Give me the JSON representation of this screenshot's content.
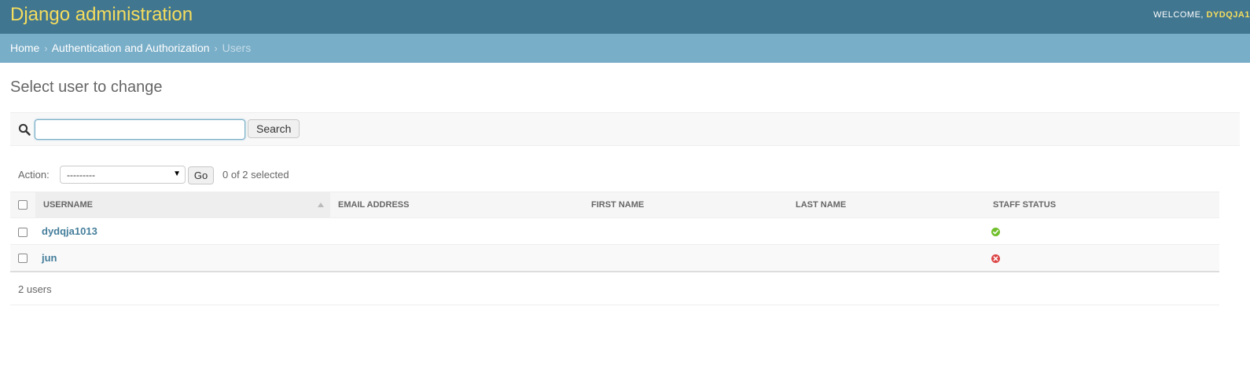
{
  "header": {
    "site_name": "Django administration",
    "welcome_label": "WELCOME,",
    "username": "DYDQJA1"
  },
  "breadcrumbs": {
    "home": "Home",
    "section": "Authentication and Authorization",
    "current": "Users"
  },
  "page_title": "Select user to change",
  "search": {
    "value": "",
    "button_label": "Search"
  },
  "actions": {
    "label": "Action:",
    "selected_option": "---------",
    "go_label": "Go",
    "selected_count": "0 of 2 selected"
  },
  "table": {
    "columns": [
      "USERNAME",
      "EMAIL ADDRESS",
      "FIRST NAME",
      "LAST NAME",
      "STAFF STATUS"
    ],
    "rows": [
      {
        "username": "dydqja1013",
        "email": "",
        "first_name": "",
        "last_name": "",
        "staff_status": "yes"
      },
      {
        "username": "jun",
        "email": "",
        "first_name": "",
        "last_name": "",
        "staff_status": "no"
      }
    ]
  },
  "paginator": {
    "count_label": "2 users"
  },
  "colors": {
    "header_bg": "#417690",
    "breadcrumb_bg": "#79aec8",
    "site_name": "#f5dd5d",
    "link": "#447e9b",
    "status_yes": "#70bf2b",
    "status_no": "#dd4646"
  },
  "icons": {
    "search": "magnifier-icon",
    "sort": "sort-ascending-icon",
    "status_yes": "check-circle-icon",
    "status_no": "x-circle-icon"
  }
}
